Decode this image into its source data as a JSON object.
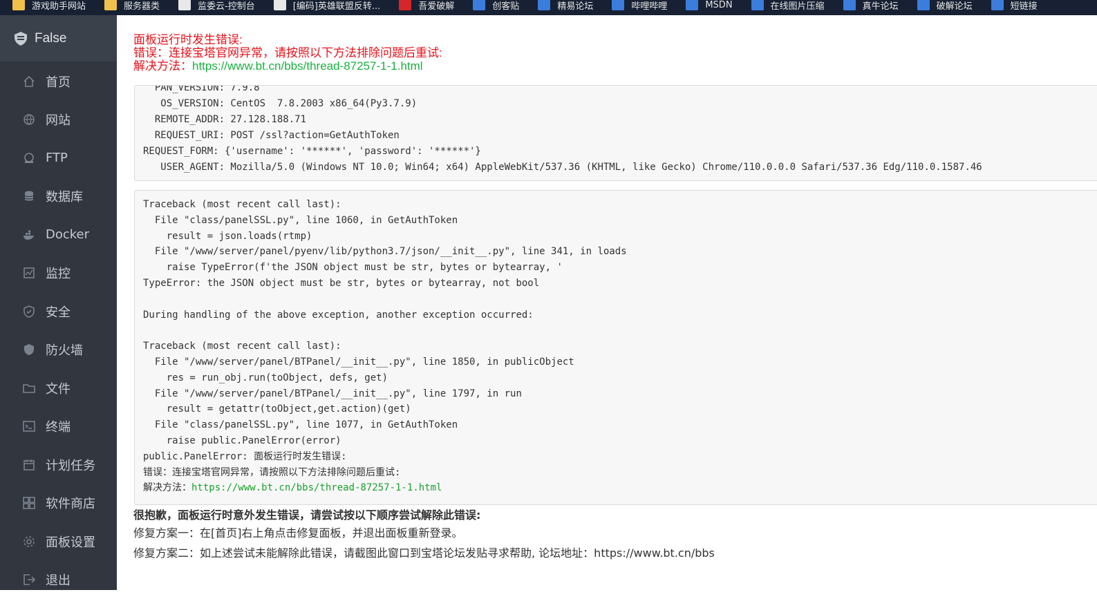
{
  "bookmarks": [
    {
      "label": "游戏助手网站",
      "icon": "folder-icon"
    },
    {
      "label": "服务器类",
      "icon": "folder-icon"
    },
    {
      "label": "监委云-控制台",
      "icon": "page-icon"
    },
    {
      "label": "[编码]英雄联盟反转...",
      "icon": "page-icon"
    },
    {
      "label": "吾爱破解",
      "icon": "site-icon"
    },
    {
      "label": "创客贴",
      "icon": "site-icon"
    },
    {
      "label": "精易论坛",
      "icon": "site-icon"
    },
    {
      "label": "哔哩哔哩",
      "icon": "bilibili-icon"
    },
    {
      "label": "MSDN",
      "icon": "site-icon"
    },
    {
      "label": "在线图片压缩",
      "icon": "site-icon"
    },
    {
      "label": "真牛论坛",
      "icon": "site-icon"
    },
    {
      "label": "破解论坛",
      "icon": "site-icon"
    },
    {
      "label": "短链接",
      "icon": "link-icon"
    }
  ],
  "sidebar": {
    "brand": "False",
    "items": [
      {
        "label": "首页",
        "icon": "home-icon"
      },
      {
        "label": "网站",
        "icon": "globe-icon"
      },
      {
        "label": "FTP",
        "icon": "ftp-icon"
      },
      {
        "label": "数据库",
        "icon": "database-icon"
      },
      {
        "label": "Docker",
        "icon": "docker-icon"
      },
      {
        "label": "监控",
        "icon": "monitor-icon"
      },
      {
        "label": "安全",
        "icon": "shield-check-icon"
      },
      {
        "label": "防火墙",
        "icon": "firewall-icon"
      },
      {
        "label": "文件",
        "icon": "folder-icon"
      },
      {
        "label": "终端",
        "icon": "terminal-icon"
      },
      {
        "label": "计划任务",
        "icon": "calendar-icon"
      },
      {
        "label": "软件商店",
        "icon": "apps-icon"
      },
      {
        "label": "面板设置",
        "icon": "gear-icon"
      },
      {
        "label": "退出",
        "icon": "logout-icon"
      }
    ]
  },
  "error_header": {
    "line1": "面板运行时发生错误:",
    "line2": "错误：连接宝塔官网异常，请按照以下方法排除问题后重试:",
    "line3_prefix": "解决方法：",
    "line3_link": "https://www.bt.cn/bbs/thread-87257-1-1.html"
  },
  "env_info": [
    "  PAN_VERSION: 7.9.8",
    "   OS_VERSION: CentOS  7.8.2003 x86_64(Py3.7.9)",
    "  REMOTE_ADDR: 27.128.188.71",
    "  REQUEST_URI: POST /ssl?action=GetAuthToken",
    "REQUEST_FORM: {'username': '******', 'password': '******'}",
    "   USER_AGENT: Mozilla/5.0 (Windows NT 10.0; Win64; x64) AppleWebKit/537.36 (KHTML, like Gecko) Chrome/110.0.0.0 Safari/537.36 Edg/110.0.1587.46"
  ],
  "traceback": [
    "Traceback (most recent call last):",
    "  File \"class/panelSSL.py\", line 1060, in GetAuthToken",
    "    result = json.loads(rtmp)",
    "  File \"/www/server/panel/pyenv/lib/python3.7/json/__init__.py\", line 341, in loads",
    "    raise TypeError(f'the JSON object must be str, bytes or bytearray, '",
    "TypeError: the JSON object must be str, bytes or bytearray, not bool",
    "",
    "During handling of the above exception, another exception occurred:",
    "",
    "Traceback (most recent call last):",
    "  File \"/www/server/panel/BTPanel/__init__.py\", line 1850, in publicObject",
    "    res = run_obj.run(toObject, defs, get)",
    "  File \"/www/server/panel/BTPanel/__init__.py\", line 1797, in run",
    "    result = getattr(toObject,get.action)(get)",
    "  File \"class/panelSSL.py\", line 1077, in GetAuthToken",
    "    raise public.PanelError(error)",
    "public.PanelError: 面板运行时发生错误:",
    "错误：连接宝塔官网异常，请按照以下方法排除问题后重试:"
  ],
  "traceback_solution": {
    "prefix": "解决方法：",
    "link": "https://www.bt.cn/bbs/thread-87257-1-1.html"
  },
  "footer": {
    "title": "很抱歉，面板运行时意外发生错误，请尝试按以下顺序尝试解除此错误:",
    "fix1": "修复方案一：在[首页]右上角点击修复面板，并退出面板重新登录。",
    "fix2": "修复方案二：如上述尝试未能解除此错误，请截图此窗口到宝塔论坛发贴寻求帮助, 论坛地址：https://www.bt.cn/bbs"
  }
}
